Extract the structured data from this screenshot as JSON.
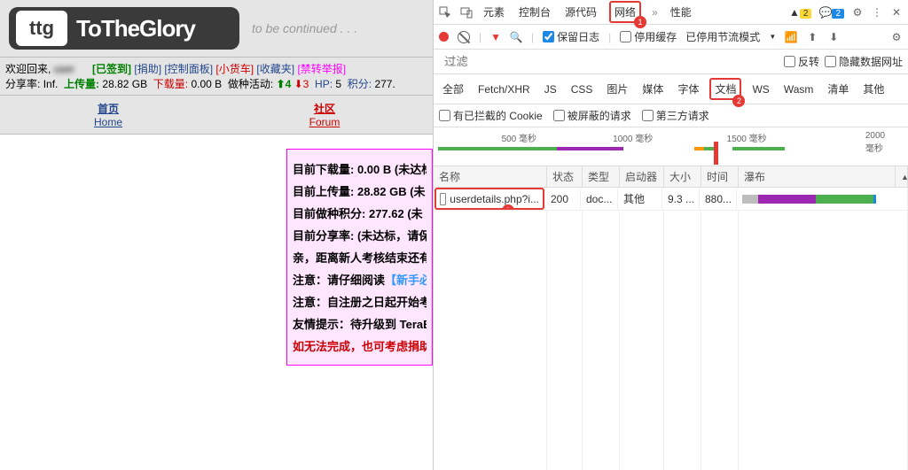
{
  "left": {
    "logo_sq": "ttg",
    "logo_txt": "ToTheGlory",
    "tbc": "to be continued . . .",
    "userbar": {
      "welcome": "欢迎回来,",
      "signed": "[已签到]",
      "donate": "[捐助]",
      "cpanel": "[控制面板]",
      "truck": "[小货车]",
      "fav": "[收藏夹]",
      "ban": "[禁转举报]",
      "share_label": "分享率:",
      "share_val": "Inf.",
      "up_label": "上传量:",
      "up_val": "28.82 GB",
      "dn_label": "下载量:",
      "dn_val": "0.00 B",
      "seed_label": "做种活动:",
      "seed_up": "4",
      "seed_dn": "3",
      "hp_label": "HP:",
      "hp_val": "5",
      "pts_label": "积分:",
      "pts_val": "277."
    },
    "nav": [
      {
        "cn": "首页",
        "en": "Home",
        "active": false
      },
      {
        "cn": "社区",
        "en": "Forum",
        "active": true
      }
    ],
    "pinkbox": {
      "r1a": "目前下载量:",
      "r1b": "0.00 B (未达标",
      "r2a": "目前上传量:",
      "r2b": "28.82 GB (未",
      "r3a": "目前做种积分:",
      "r3b": "277.62 (未",
      "r4a": "目前分享率:",
      "r4b": "(未达标，请保",
      "r5": "亲，距离新人考核结束还有",
      "r6a": "注意：请仔细阅读",
      "r6b": "【新手必",
      "r7": "注意：自注册之日起开始考",
      "r8": "友情提示：待升级到 TeraB",
      "r9a": "如无法完成，也可考虑",
      "r9b": "捐助"
    }
  },
  "dt": {
    "tabs": [
      "元素",
      "控制台",
      "源代码",
      "网络",
      "性能"
    ],
    "active_tab": "网络",
    "warn_count": "2",
    "info_count": "2",
    "preserve": "保留日志",
    "disable_cache": "停用缓存",
    "throttle": "已停用节流模式",
    "filter_placeholder": "过滤",
    "invert": "反转",
    "hide_data_urls": "隐藏数据网址",
    "ftabs": [
      "全部",
      "Fetch/XHR",
      "JS",
      "CSS",
      "图片",
      "媒体",
      "字体",
      "文档",
      "WS",
      "Wasm",
      "清单",
      "其他"
    ],
    "active_ftab": "文档",
    "blocked_cookie": "有已拦截的 Cookie",
    "blocked_req": "被屏蔽的请求",
    "third_party": "第三方请求",
    "tl": {
      "l1": "500 毫秒",
      "l2": "1000 毫秒",
      "l3": "1500 毫秒",
      "l4": "2000 毫秒"
    },
    "cols": {
      "name": "名称",
      "status": "状态",
      "type": "类型",
      "initiator": "启动器",
      "size": "大小",
      "time": "时间",
      "waterfall": "瀑布"
    },
    "row": {
      "name": "userdetails.php?i...",
      "status": "200",
      "type": "doc...",
      "initiator": "其他",
      "size": "9.3 ...",
      "time": "880..."
    }
  }
}
